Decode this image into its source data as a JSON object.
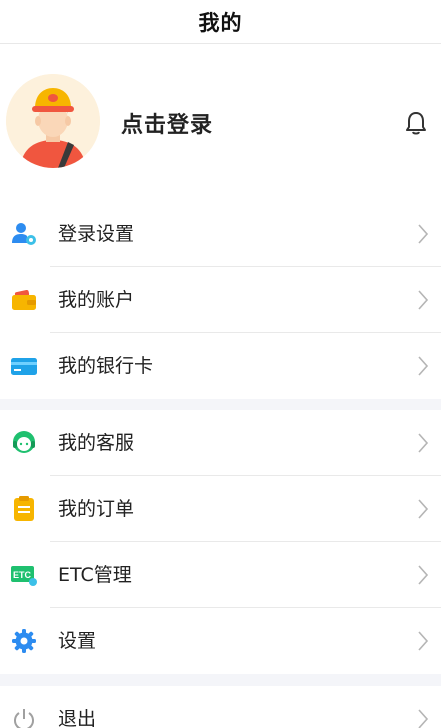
{
  "header": {
    "title": "我的"
  },
  "profile": {
    "login_label": "点击登录"
  },
  "menu_group_1": [
    {
      "label": "登录设置",
      "icon": "user-settings-icon",
      "color": "#2d8cf0"
    },
    {
      "label": "我的账户",
      "icon": "wallet-icon",
      "color": "#f7b500"
    },
    {
      "label": "我的银行卡",
      "icon": "bank-card-icon",
      "color": "#1fa2e8"
    }
  ],
  "menu_group_2": [
    {
      "label": "我的客服",
      "icon": "customer-service-icon",
      "color": "#1fc06f"
    },
    {
      "label": "我的订单",
      "icon": "order-icon",
      "color": "#f7b500"
    },
    {
      "label": "ETC管理",
      "icon": "etc-icon",
      "color": "#1fc06f"
    },
    {
      "label": "设置",
      "icon": "gear-icon",
      "color": "#2d8cf0"
    }
  ],
  "menu_group_3": [
    {
      "label": "退出",
      "icon": "power-icon",
      "color": "#9a9a9a"
    }
  ]
}
